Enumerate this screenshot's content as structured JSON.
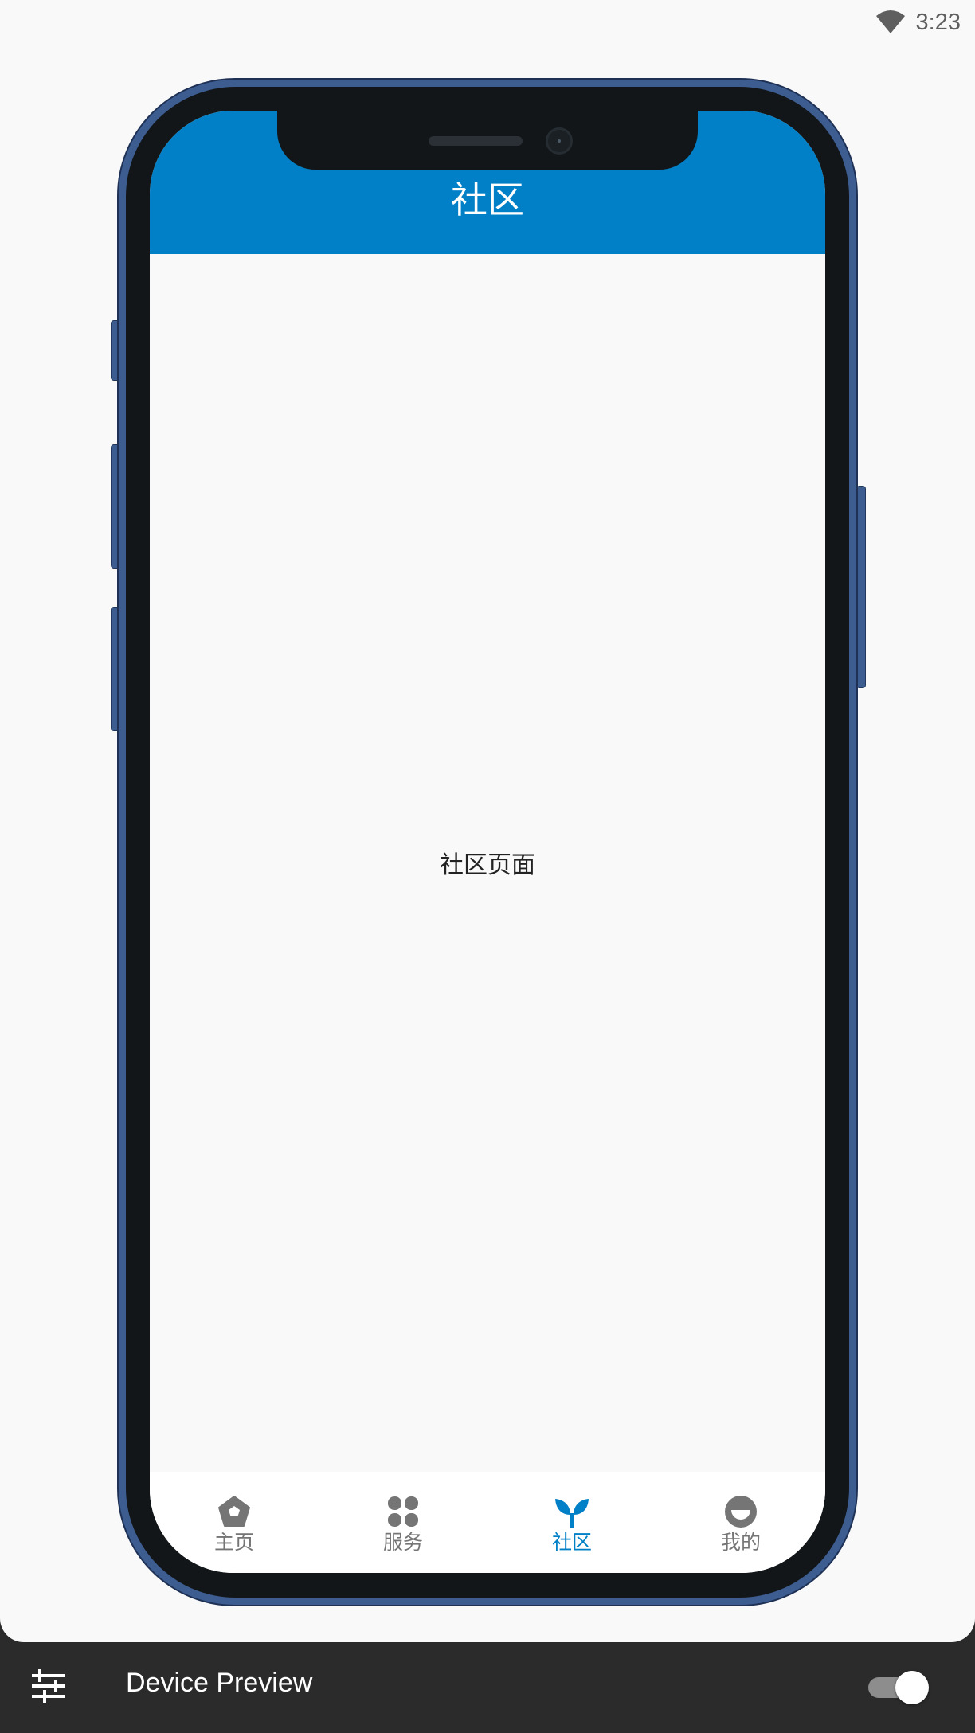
{
  "status_bar": {
    "time": "3:23",
    "wifi_icon": "wifi-icon"
  },
  "app": {
    "title": "社区",
    "body_text": "社区页面",
    "accent_color": "#0180c7"
  },
  "bottom_nav": {
    "items": [
      {
        "label": "主页",
        "icon": "home-pentagon-icon",
        "active": false
      },
      {
        "label": "服务",
        "icon": "grid-clover-icon",
        "active": false
      },
      {
        "label": "社区",
        "icon": "sprout-icon",
        "active": true
      },
      {
        "label": "我的",
        "icon": "profile-face-icon",
        "active": false
      }
    ]
  },
  "device_preview": {
    "title": "Device Preview",
    "settings_icon": "tune-sliders-icon",
    "toggle_on": true
  }
}
